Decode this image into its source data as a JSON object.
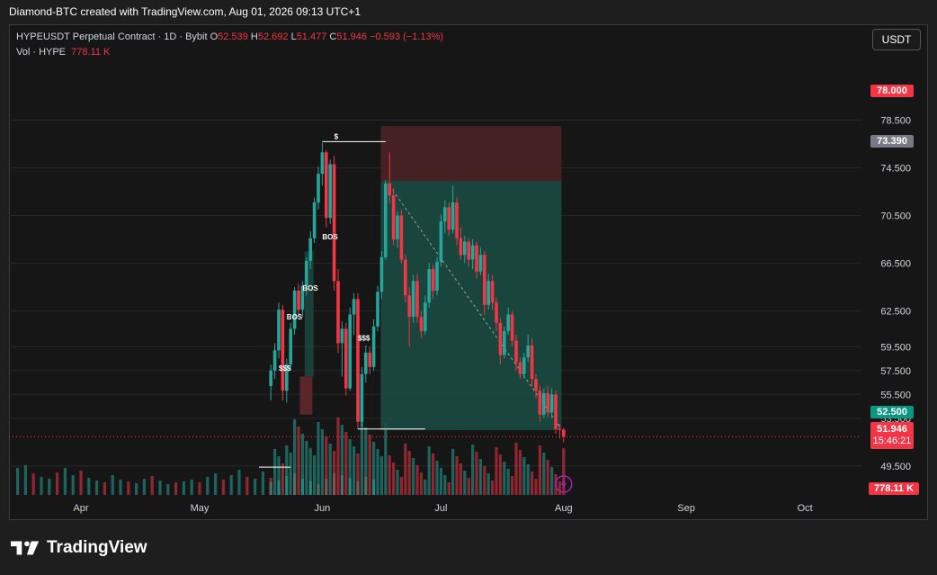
{
  "header": {
    "attribution": "Diamond-BTC created with TradingView.com, Aug 01, 2026 09:13 UTC+1"
  },
  "legend": {
    "symbol": "HYPEUSDT Perpetual Contract · 1D · Bybit",
    "o_label": "O",
    "o_value": "52.539",
    "h_label": "H",
    "h_value": "52.692",
    "l_label": "L",
    "l_value": "51.477",
    "c_label": "C",
    "c_value": "51.946",
    "change": "−0.593 (−1.13%)",
    "vol_label": "Vol · HYPE",
    "vol_value": "778.11 K"
  },
  "currency_button": "USDT",
  "price_tags": {
    "target": "78.000",
    "entry": "73.390",
    "stop": "52.500",
    "last_price": "51.946",
    "countdown": "15:46:21",
    "volume": "778.11 K"
  },
  "branding": {
    "logo_text": "TradingView"
  },
  "colors": {
    "up": "#26a69a",
    "down": "#f23645",
    "background": "#161616",
    "grid": "#262626",
    "zone_red": "#4a2226",
    "zone_green": "#1b4a41",
    "tag_red": "#f23645",
    "tag_gray": "#787b86",
    "tag_green": "#089981"
  },
  "icons": [
    "tradingview-logo-icon",
    "lightning-icon"
  ],
  "chart_data": {
    "type": "candlestick",
    "symbol": "HYPEUSDT",
    "timeframe": "1D",
    "y_ticks": [
      "78.500",
      "74.500",
      "70.500",
      "66.500",
      "62.500",
      "59.500",
      "57.500",
      "55.500",
      "53.500",
      "49.500"
    ],
    "x_ticks": [
      "Apr",
      "May",
      "Jun",
      "Jul",
      "Aug",
      "Sep",
      "Oct"
    ],
    "last_price": 51.946,
    "ohlc": [
      {
        "date": "2026-05-19",
        "o": 56.2,
        "h": 58.0,
        "l": 55.0,
        "c": 57.5
      },
      {
        "date": "2026-05-20",
        "o": 57.5,
        "h": 59.8,
        "l": 56.8,
        "c": 59.2
      },
      {
        "date": "2026-05-21",
        "o": 59.2,
        "h": 63.2,
        "l": 58.5,
        "c": 62.6
      },
      {
        "date": "2026-05-22",
        "o": 62.6,
        "h": 63.0,
        "l": 55.0,
        "c": 55.8
      },
      {
        "date": "2026-05-23",
        "o": 55.8,
        "h": 58.5,
        "l": 54.8,
        "c": 58.0
      },
      {
        "date": "2026-05-24",
        "o": 58.0,
        "h": 61.5,
        "l": 57.5,
        "c": 61.0
      },
      {
        "date": "2026-05-25",
        "o": 61.0,
        "h": 64.5,
        "l": 60.5,
        "c": 64.2
      },
      {
        "date": "2026-05-26",
        "o": 64.2,
        "h": 64.8,
        "l": 62.2,
        "c": 62.6
      },
      {
        "date": "2026-05-27",
        "o": 62.6,
        "h": 65.0,
        "l": 62.0,
        "c": 64.6
      },
      {
        "date": "2026-05-28",
        "o": 64.6,
        "h": 67.0,
        "l": 63.8,
        "c": 66.7
      },
      {
        "date": "2026-05-29",
        "o": 66.7,
        "h": 69.2,
        "l": 66.0,
        "c": 68.6
      },
      {
        "date": "2026-05-30",
        "o": 68.6,
        "h": 72.0,
        "l": 68.2,
        "c": 71.6
      },
      {
        "date": "2026-05-31",
        "o": 71.6,
        "h": 74.6,
        "l": 71.0,
        "c": 74.0
      },
      {
        "date": "2026-06-01",
        "o": 74.0,
        "h": 76.6,
        "l": 73.0,
        "c": 75.8
      },
      {
        "date": "2026-06-02",
        "o": 75.8,
        "h": 76.0,
        "l": 69.5,
        "c": 70.3
      },
      {
        "date": "2026-06-03",
        "o": 70.3,
        "h": 75.2,
        "l": 69.8,
        "c": 74.8
      },
      {
        "date": "2026-06-04",
        "o": 74.8,
        "h": 75.5,
        "l": 64.2,
        "c": 65.0
      },
      {
        "date": "2026-06-05",
        "o": 65.0,
        "h": 66.0,
        "l": 59.0,
        "c": 59.8
      },
      {
        "date": "2026-06-06",
        "o": 59.8,
        "h": 61.6,
        "l": 57.0,
        "c": 61.0
      },
      {
        "date": "2026-06-07",
        "o": 61.0,
        "h": 61.5,
        "l": 55.4,
        "c": 56.0
      },
      {
        "date": "2026-06-08",
        "o": 56.0,
        "h": 62.8,
        "l": 55.8,
        "c": 62.2
      },
      {
        "date": "2026-06-09",
        "o": 62.2,
        "h": 64.0,
        "l": 60.5,
        "c": 63.5
      },
      {
        "date": "2026-06-10",
        "o": 63.5,
        "h": 64.0,
        "l": 52.6,
        "c": 53.2
      },
      {
        "date": "2026-06-11",
        "o": 53.2,
        "h": 57.8,
        "l": 52.8,
        "c": 57.2
      },
      {
        "date": "2026-06-12",
        "o": 57.2,
        "h": 59.6,
        "l": 56.5,
        "c": 59.0
      },
      {
        "date": "2026-06-13",
        "o": 59.0,
        "h": 59.5,
        "l": 57.2,
        "c": 57.8
      },
      {
        "date": "2026-06-14",
        "o": 57.8,
        "h": 61.8,
        "l": 57.5,
        "c": 61.2
      },
      {
        "date": "2026-06-15",
        "o": 61.2,
        "h": 64.6,
        "l": 60.8,
        "c": 64.1
      },
      {
        "date": "2026-06-16",
        "o": 64.1,
        "h": 67.5,
        "l": 63.5,
        "c": 67.0
      },
      {
        "date": "2026-06-17",
        "o": 67.0,
        "h": 73.5,
        "l": 66.8,
        "c": 73.2
      },
      {
        "date": "2026-06-18",
        "o": 73.2,
        "h": 75.8,
        "l": 71.5,
        "c": 72.2
      },
      {
        "date": "2026-06-19",
        "o": 72.2,
        "h": 72.8,
        "l": 68.0,
        "c": 68.5
      },
      {
        "date": "2026-06-20",
        "o": 68.5,
        "h": 70.8,
        "l": 67.8,
        "c": 70.5
      },
      {
        "date": "2026-06-21",
        "o": 70.5,
        "h": 71.0,
        "l": 66.5,
        "c": 66.8
      },
      {
        "date": "2026-06-22",
        "o": 66.8,
        "h": 67.2,
        "l": 63.2,
        "c": 63.8
      },
      {
        "date": "2026-06-23",
        "o": 63.8,
        "h": 64.5,
        "l": 59.5,
        "c": 62.0
      },
      {
        "date": "2026-06-24",
        "o": 62.0,
        "h": 65.5,
        "l": 61.5,
        "c": 65.0
      },
      {
        "date": "2026-06-25",
        "o": 65.0,
        "h": 65.6,
        "l": 61.5,
        "c": 62.0
      },
      {
        "date": "2026-06-26",
        "o": 62.0,
        "h": 62.5,
        "l": 60.2,
        "c": 60.8
      },
      {
        "date": "2026-06-27",
        "o": 60.8,
        "h": 63.8,
        "l": 60.5,
        "c": 63.2
      },
      {
        "date": "2026-06-28",
        "o": 63.2,
        "h": 66.5,
        "l": 62.8,
        "c": 66.0
      },
      {
        "date": "2026-06-29",
        "o": 66.0,
        "h": 66.4,
        "l": 63.5,
        "c": 64.2
      },
      {
        "date": "2026-06-30",
        "o": 64.2,
        "h": 67.0,
        "l": 63.8,
        "c": 66.6
      },
      {
        "date": "2026-07-01",
        "o": 66.6,
        "h": 70.6,
        "l": 66.2,
        "c": 70.0
      },
      {
        "date": "2026-07-02",
        "o": 70.0,
        "h": 71.8,
        "l": 69.0,
        "c": 71.2
      },
      {
        "date": "2026-07-03",
        "o": 71.2,
        "h": 71.6,
        "l": 68.8,
        "c": 69.3
      },
      {
        "date": "2026-07-04",
        "o": 69.3,
        "h": 73.0,
        "l": 69.0,
        "c": 71.6
      },
      {
        "date": "2026-07-05",
        "o": 71.6,
        "h": 72.0,
        "l": 68.0,
        "c": 68.6
      },
      {
        "date": "2026-07-06",
        "o": 68.6,
        "h": 69.5,
        "l": 66.8,
        "c": 67.2
      },
      {
        "date": "2026-07-07",
        "o": 67.2,
        "h": 68.8,
        "l": 66.5,
        "c": 68.3
      },
      {
        "date": "2026-07-08",
        "o": 68.3,
        "h": 68.6,
        "l": 66.2,
        "c": 66.8
      },
      {
        "date": "2026-07-09",
        "o": 66.8,
        "h": 68.5,
        "l": 66.0,
        "c": 68.0
      },
      {
        "date": "2026-07-10",
        "o": 68.0,
        "h": 68.3,
        "l": 65.2,
        "c": 65.8
      },
      {
        "date": "2026-07-11",
        "o": 65.8,
        "h": 67.8,
        "l": 65.5,
        "c": 67.2
      },
      {
        "date": "2026-07-12",
        "o": 67.2,
        "h": 67.5,
        "l": 62.2,
        "c": 63.0
      },
      {
        "date": "2026-07-13",
        "o": 63.0,
        "h": 65.6,
        "l": 62.6,
        "c": 65.0
      },
      {
        "date": "2026-07-14",
        "o": 65.0,
        "h": 65.5,
        "l": 62.6,
        "c": 63.2
      },
      {
        "date": "2026-07-15",
        "o": 63.2,
        "h": 63.6,
        "l": 60.8,
        "c": 61.5
      },
      {
        "date": "2026-07-16",
        "o": 61.5,
        "h": 61.9,
        "l": 58.0,
        "c": 58.8
      },
      {
        "date": "2026-07-17",
        "o": 58.8,
        "h": 61.2,
        "l": 58.5,
        "c": 60.8
      },
      {
        "date": "2026-07-18",
        "o": 60.8,
        "h": 62.8,
        "l": 60.5,
        "c": 62.2
      },
      {
        "date": "2026-07-19",
        "o": 62.2,
        "h": 62.5,
        "l": 59.5,
        "c": 60.0
      },
      {
        "date": "2026-07-20",
        "o": 60.0,
        "h": 60.5,
        "l": 57.5,
        "c": 58.2
      },
      {
        "date": "2026-07-21",
        "o": 58.2,
        "h": 58.6,
        "l": 56.8,
        "c": 57.2
      },
      {
        "date": "2026-07-22",
        "o": 57.2,
        "h": 59.0,
        "l": 56.8,
        "c": 58.6
      },
      {
        "date": "2026-07-23",
        "o": 58.6,
        "h": 60.5,
        "l": 58.2,
        "c": 59.6
      },
      {
        "date": "2026-07-24",
        "o": 59.6,
        "h": 60.2,
        "l": 56.2,
        "c": 56.8
      },
      {
        "date": "2026-07-25",
        "o": 56.8,
        "h": 57.2,
        "l": 55.2,
        "c": 55.8
      },
      {
        "date": "2026-07-26",
        "o": 55.8,
        "h": 56.2,
        "l": 53.2,
        "c": 53.8
      },
      {
        "date": "2026-07-27",
        "o": 53.8,
        "h": 56.0,
        "l": 53.5,
        "c": 55.6
      },
      {
        "date": "2026-07-28",
        "o": 55.6,
        "h": 56.2,
        "l": 53.6,
        "c": 54.0
      },
      {
        "date": "2026-07-29",
        "o": 54.0,
        "h": 56.0,
        "l": 53.5,
        "c": 55.5
      },
      {
        "date": "2026-07-30",
        "o": 55.5,
        "h": 55.8,
        "l": 52.2,
        "c": 52.6
      },
      {
        "date": "2026-07-31",
        "o": 52.6,
        "h": 53.0,
        "l": 51.8,
        "c": 52.539
      },
      {
        "date": "2026-08-01",
        "o": 52.539,
        "h": 52.692,
        "l": 51.477,
        "c": 51.946
      }
    ],
    "volume_by_month": {
      "Mar-Apr": [
        40,
        30,
        26,
        18,
        35,
        28,
        22,
        30,
        33,
        24,
        20,
        18,
        25,
        30,
        22,
        27,
        19,
        16,
        14,
        22,
        17,
        15,
        13,
        18,
        21,
        16,
        12,
        14,
        15,
        17
      ],
      "May": [
        14,
        20,
        24,
        17,
        22,
        28,
        20,
        18,
        26,
        19,
        16,
        21,
        24,
        18,
        15,
        12,
        18,
        24,
        22,
        19,
        15,
        20,
        17
      ]
    },
    "annotations": [
      "BOS",
      "BOS",
      "BOS",
      "$$$",
      "$$$",
      "$"
    ],
    "position_tool": {
      "type": "short",
      "target_zone_top": 78.0,
      "entry": 73.39,
      "target": 52.5
    }
  }
}
